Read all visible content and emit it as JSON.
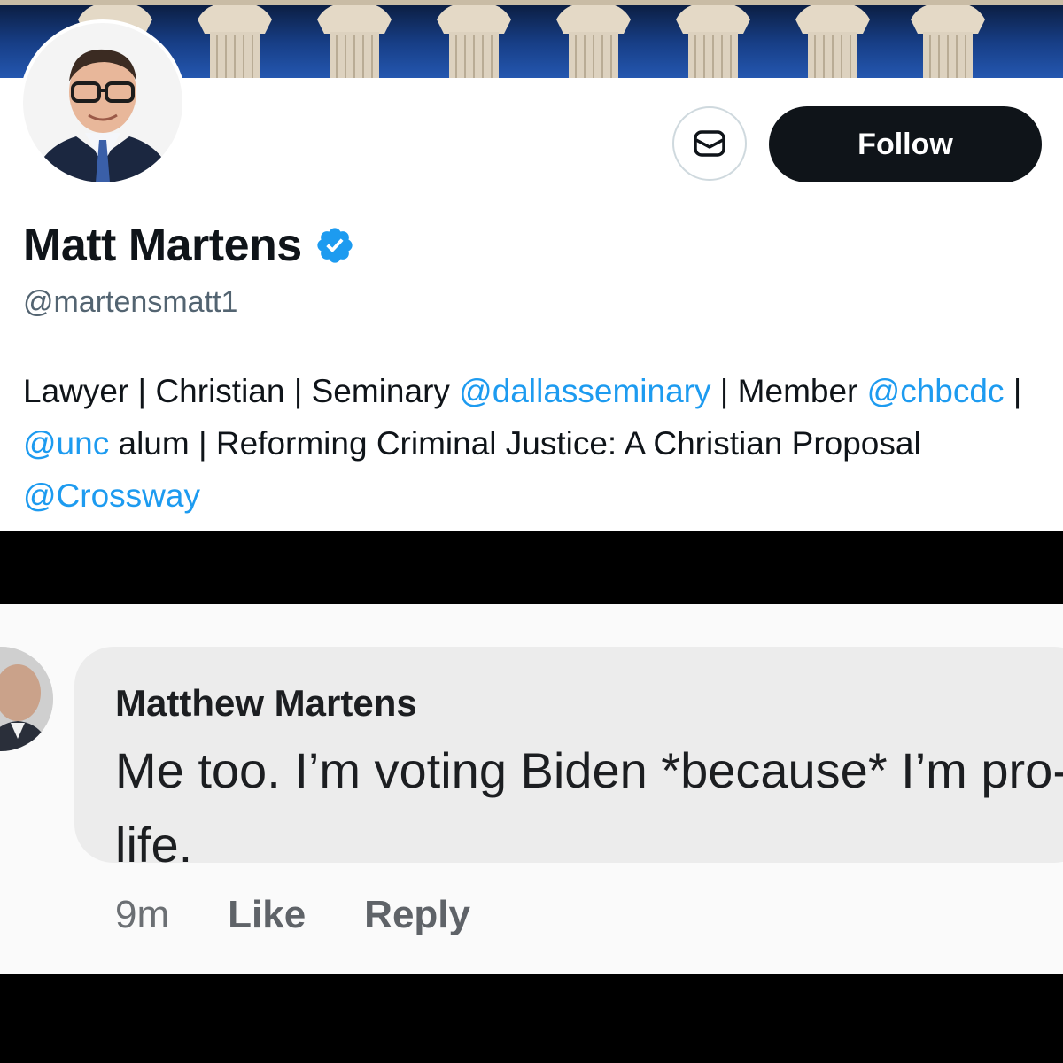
{
  "profile": {
    "display_name": "Matt Martens",
    "handle": "@martensmatt1",
    "follow_label": "Follow",
    "message_icon": "envelope-icon",
    "verified_icon": "verified-badge-icon",
    "bio": {
      "p1": "Lawyer | Christian | Seminary ",
      "m1": "@dallasseminary",
      "p2": " | Member ",
      "m2": "@chbcdc",
      "p3": " | ",
      "m3": "@unc",
      "p4": " alum | Reforming Criminal Justice: A Christian Proposal ",
      "m4": "@Crossway"
    },
    "colors": {
      "mention": "#1d9bf0",
      "verified": "#1d9bf0",
      "follow_bg": "#0f1419"
    }
  },
  "comment": {
    "author": "Matthew Martens",
    "text": "Me too. I’m voting Biden *because* I’m pro-life.",
    "timestamp": "9m",
    "like_label": "Like",
    "reply_label": "Reply"
  }
}
